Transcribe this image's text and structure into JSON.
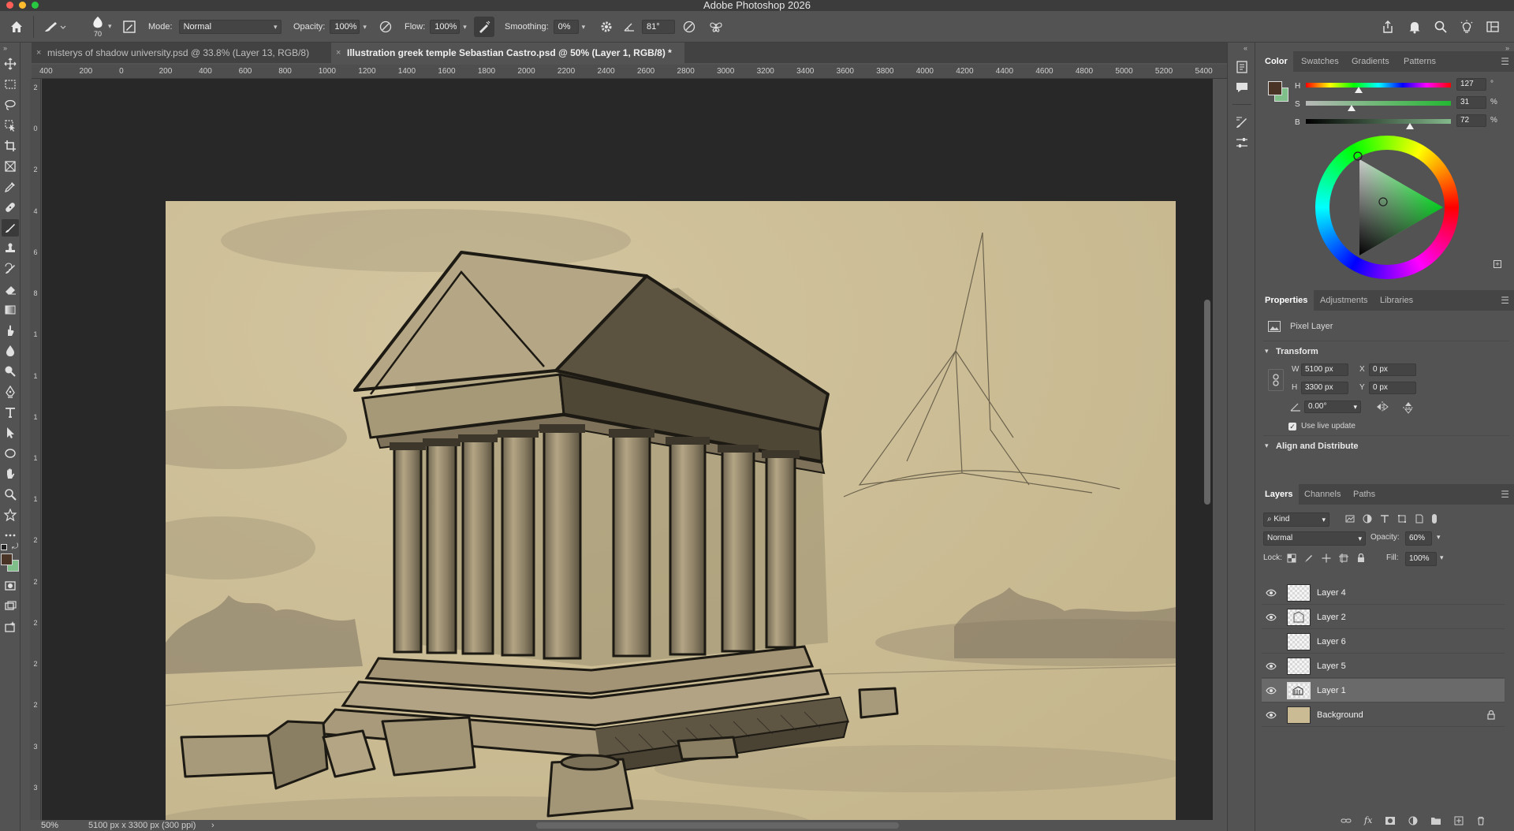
{
  "app": {
    "title": "Adobe Photoshop 2026"
  },
  "options_bar": {
    "brush_size": "70",
    "mode_label": "Mode:",
    "mode_value": "Normal",
    "opacity_label": "Opacity:",
    "opacity_value": "100%",
    "flow_label": "Flow:",
    "flow_value": "100%",
    "smoothing_label": "Smoothing:",
    "smoothing_value": "0%",
    "angle_value": "81°"
  },
  "tabs": [
    {
      "label": "misterys of shadow university.psd @ 33.8% (Layer 13, RGB/8)",
      "close": "×",
      "active": false
    },
    {
      "label": "Illustration greek temple Sebastian Castro.psd @ 50% (Layer 1, RGB/8) *",
      "close": "×",
      "active": true
    }
  ],
  "ruler": {
    "h_labels": [
      "400",
      "200",
      "0",
      "200",
      "400",
      "600",
      "800",
      "1000",
      "1200",
      "1400",
      "1600",
      "1800",
      "2000",
      "2200",
      "2400",
      "2600",
      "2800",
      "3000",
      "3200",
      "3400",
      "3600",
      "3800",
      "4000",
      "4200",
      "4400",
      "4600",
      "4800",
      "5000",
      "5200",
      "5400"
    ],
    "v_labels": [
      "2",
      "0",
      "2",
      "4",
      "6",
      "8",
      "1",
      "1",
      "1",
      "1",
      "1",
      "2",
      "2",
      "2",
      "2",
      "2",
      "3",
      "3"
    ]
  },
  "status": {
    "zoom": "50%",
    "doc_info": "5100 px x 3300 px (300 ppi)",
    "arrow": "›"
  },
  "colors": {
    "foreground": "#4a3426",
    "background": "#7fbf8a",
    "canvas_paper": "#cabb94",
    "ui_panel": "#535353",
    "ui_dark": "#282828"
  },
  "color_panel": {
    "tabs": [
      "Color",
      "Swatches",
      "Gradients",
      "Patterns"
    ],
    "sliders": [
      {
        "label": "H",
        "value": "127",
        "unit": "°",
        "fraction": 0.35
      },
      {
        "label": "S",
        "value": "31",
        "unit": "%",
        "fraction": 0.31
      },
      {
        "label": "B",
        "value": "72",
        "unit": "%",
        "fraction": 0.72
      }
    ]
  },
  "properties_panel": {
    "tabs": [
      "Properties",
      "Adjustments",
      "Libraries"
    ],
    "kind": "Pixel Layer",
    "transform_title": "Transform",
    "w_label": "W",
    "w_value": "5100 px",
    "h_label": "H",
    "h_value": "3300 px",
    "x_label": "X",
    "x_value": "0 px",
    "y_label": "Y",
    "y_value": "0 px",
    "angle_value": "0.00°",
    "live_update": "Use live update",
    "align_title": "Align and Distribute"
  },
  "layers_panel": {
    "tabs": [
      "Layers",
      "Channels",
      "Paths"
    ],
    "filter_value": "Kind",
    "blend_mode": "Normal",
    "opacity_label": "Opacity:",
    "opacity_value": "60%",
    "lock_label": "Lock:",
    "fill_label": "Fill:",
    "fill_value": "100%",
    "layers": [
      {
        "name": "Layer 4",
        "visible": true,
        "selected": false
      },
      {
        "name": "Layer 2",
        "visible": true,
        "selected": false
      },
      {
        "name": "Layer 6",
        "visible": false,
        "selected": false
      },
      {
        "name": "Layer 5",
        "visible": true,
        "selected": false
      },
      {
        "name": "Layer 1",
        "visible": true,
        "selected": true
      },
      {
        "name": "Background",
        "visible": true,
        "selected": false,
        "locked": true
      }
    ]
  },
  "icons": {
    "toolbar": [
      "move-icon",
      "marquee-icon",
      "lasso-icon",
      "object-select-icon",
      "crop-icon",
      "frame-icon",
      "eyedropper-icon",
      "healing-icon",
      "brush-icon",
      "stamp-icon",
      "history-brush-icon",
      "eraser-icon",
      "gradient-icon",
      "smudge-icon",
      "blur-icon",
      "dodge-icon",
      "pen-icon",
      "type-icon",
      "path-select-icon",
      "shape-icon",
      "hand-icon",
      "zoom-icon",
      "star-icon",
      "more-icon"
    ],
    "right_strip": [
      "history-icon",
      "comments-icon",
      "brush-settings-icon",
      "adjust-icon"
    ]
  }
}
